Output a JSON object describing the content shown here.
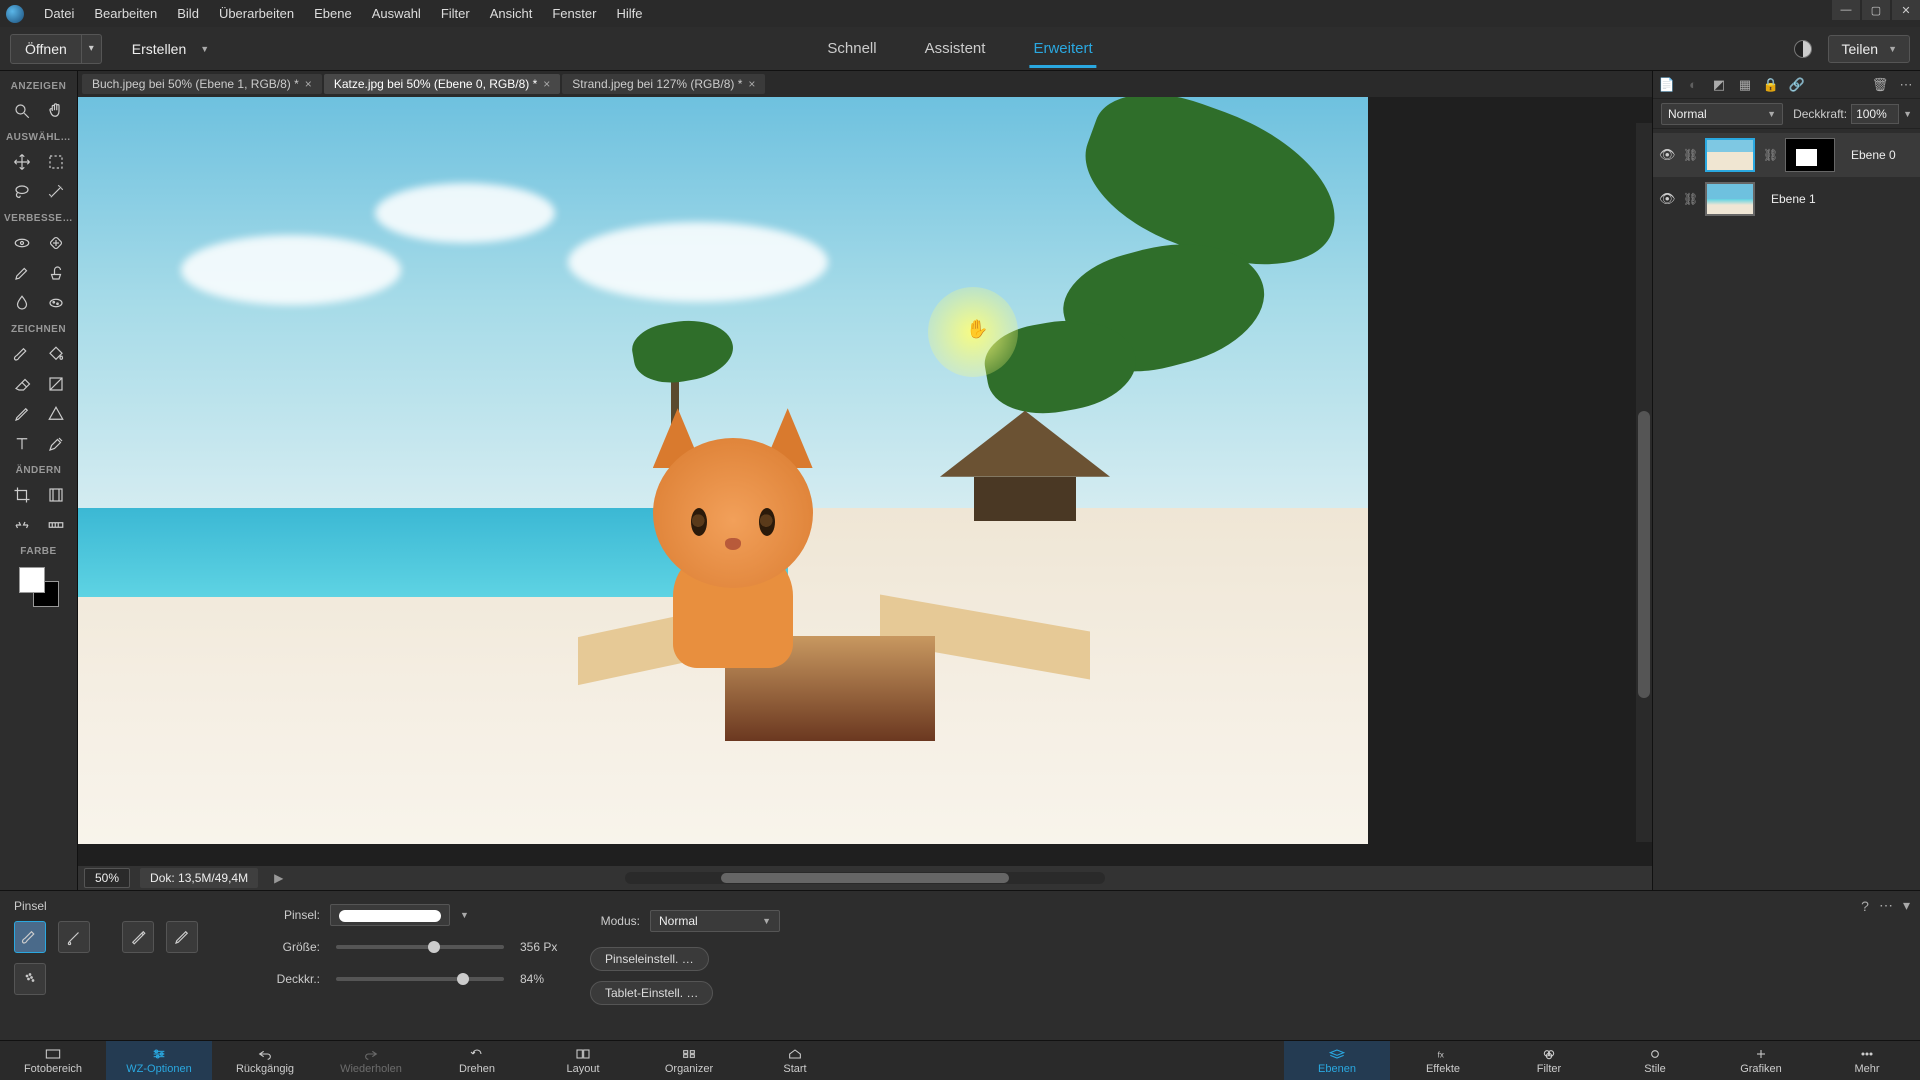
{
  "menu": {
    "items": [
      "Datei",
      "Bearbeiten",
      "Bild",
      "Überarbeiten",
      "Ebene",
      "Auswahl",
      "Filter",
      "Ansicht",
      "Fenster",
      "Hilfe"
    ]
  },
  "topbar": {
    "open": "Öffnen",
    "create": "Erstellen",
    "modes": {
      "quick": "Schnell",
      "guided": "Assistent",
      "expert": "Erweitert"
    },
    "share": "Teilen"
  },
  "docs": [
    {
      "label": "Buch.jpeg bei 50% (Ebene 1, RGB/8) *",
      "active": false
    },
    {
      "label": "Katze.jpg bei 50% (Ebene 0, RGB/8) *",
      "active": true
    },
    {
      "label": "Strand.jpeg bei 127% (RGB/8) *",
      "active": false
    }
  ],
  "toolbox": {
    "sections": {
      "view": "ANZEIGEN",
      "select": "AUSWÄHL…",
      "enhance": "VERBESSE…",
      "draw": "ZEICHNEN",
      "modify": "ÄNDERN",
      "color": "FARBE"
    }
  },
  "status": {
    "zoom": "50%",
    "doc": "Dok: 13,5M/49,4M"
  },
  "layerspanel": {
    "blend": "Normal",
    "opacity_label": "Deckkraft:",
    "opacity_value": "100%",
    "layers": [
      {
        "name": "Ebene 0",
        "selected": true,
        "has_mask": true
      },
      {
        "name": "Ebene 1",
        "selected": false,
        "has_mask": false
      }
    ]
  },
  "tooloptions": {
    "title": "Pinsel",
    "brush_label": "Pinsel:",
    "mode_label": "Modus:",
    "mode_value": "Normal",
    "size_label": "Größe:",
    "size_value": "356 Px",
    "opacity_label": "Deckkr.:",
    "opacity_value": "84%",
    "brush_settings": "Pinseleinstell. …",
    "tablet_settings": "Tablet-Einstell. …"
  },
  "bottombar": {
    "left": [
      {
        "key": "fotobereich",
        "label": "Fotobereich"
      },
      {
        "key": "wzoptionen",
        "label": "WZ-Optionen",
        "active": true
      },
      {
        "key": "rueckgaengig",
        "label": "Rückgängig"
      },
      {
        "key": "wiederholen",
        "label": "Wiederholen"
      },
      {
        "key": "drehen",
        "label": "Drehen"
      },
      {
        "key": "layout",
        "label": "Layout"
      },
      {
        "key": "organizer",
        "label": "Organizer"
      },
      {
        "key": "start",
        "label": "Start"
      }
    ],
    "right": [
      {
        "key": "ebenen",
        "label": "Ebenen",
        "active": true
      },
      {
        "key": "effekte",
        "label": "Effekte"
      },
      {
        "key": "filter",
        "label": "Filter"
      },
      {
        "key": "stile",
        "label": "Stile"
      },
      {
        "key": "grafiken",
        "label": "Grafiken"
      },
      {
        "key": "mehr",
        "label": "Mehr"
      }
    ]
  },
  "colors": {
    "accent": "#2aa8e0"
  }
}
